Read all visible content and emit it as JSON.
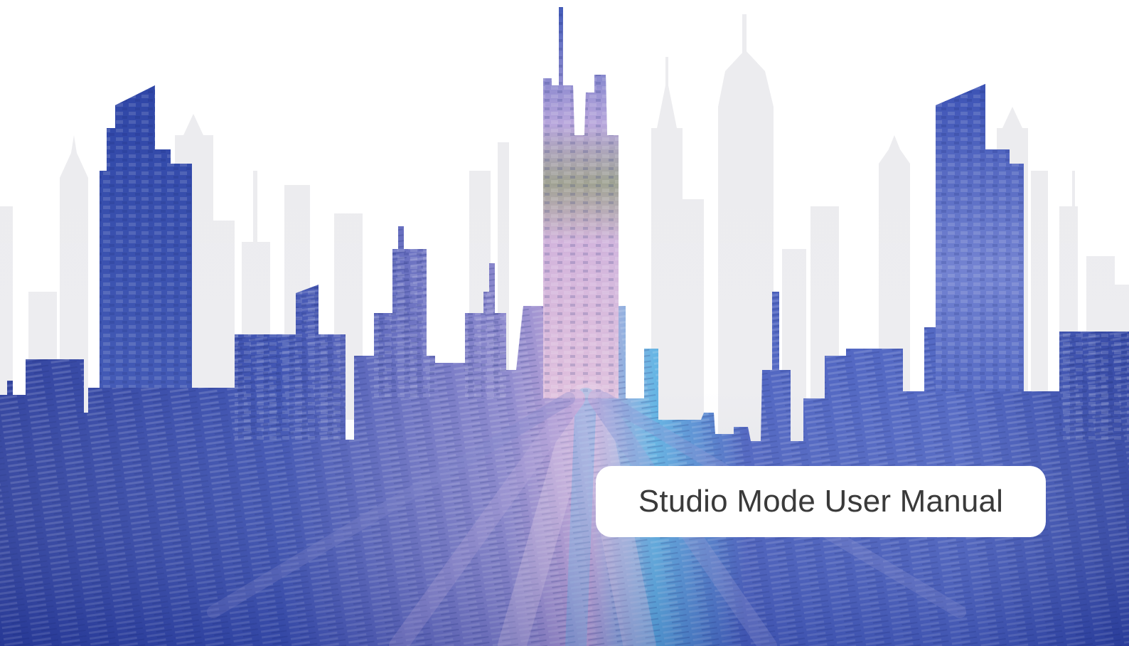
{
  "cover": {
    "title": "Studio Mode User Manual"
  },
  "colors": {
    "background": "#ffffff",
    "ghost_skyline": "#ececef",
    "deep_blue": "#2a3f9e",
    "mid_blue": "#4258b8",
    "lavender": "#c8b0e0",
    "pink_light": "#e6c6dc",
    "cyan": "#4aa8e0",
    "title_text": "#3a3a3a",
    "title_box": "#ffffff"
  }
}
